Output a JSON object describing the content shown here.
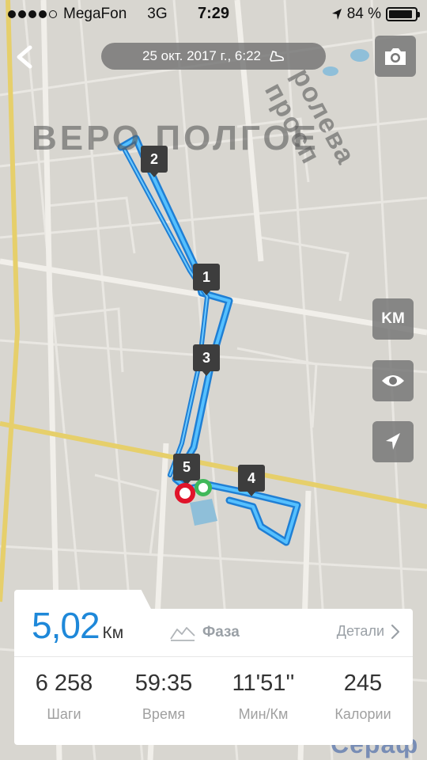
{
  "status_bar": {
    "carrier": "MegaFon",
    "network": "3G",
    "time": "7:29",
    "battery": "84 %"
  },
  "header": {
    "date": "25 окт. 2017 г., 6:22"
  },
  "map": {
    "district_label": "ВЕРО ПОЛГОЕ",
    "street_label": "ролева просп",
    "bottom_label": "Сераф",
    "markers": [
      "1",
      "2",
      "3",
      "4",
      "5"
    ]
  },
  "controls": {
    "km_label": "KM"
  },
  "summary": {
    "distance_value": "5,02",
    "distance_unit": "Км",
    "phase_label": "Фаза",
    "details_label": "Детали",
    "stats": [
      {
        "value": "6 258",
        "label": "Шаги"
      },
      {
        "value": "59:35",
        "label": "Время"
      },
      {
        "value": "11'51''",
        "label": "Мин/Км"
      },
      {
        "value": "245",
        "label": "Калории"
      }
    ]
  },
  "colors": {
    "accent": "#1e88d9",
    "route": "#2a9df4",
    "start": "#e0142a",
    "finish": "#40b85a"
  }
}
